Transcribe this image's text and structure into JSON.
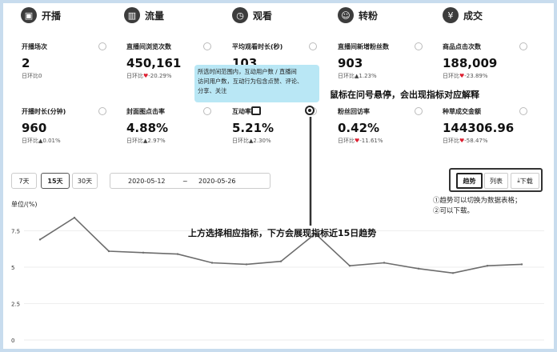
{
  "tabs": [
    {
      "label": "开播",
      "icon": "video-camera-icon",
      "glyph": "▣"
    },
    {
      "label": "流量",
      "icon": "bar-chart-icon",
      "glyph": "▥"
    },
    {
      "label": "观看",
      "icon": "clock-icon",
      "glyph": "◷"
    },
    {
      "label": "转粉",
      "icon": "add-user-icon",
      "glyph": "☺"
    },
    {
      "label": "成交",
      "icon": "yen-icon",
      "glyph": "¥"
    }
  ],
  "metrics": [
    {
      "label": "开播场次",
      "value": "2",
      "change_prefix": "日环比",
      "change_arrow": "",
      "change": "0"
    },
    {
      "label": "直播间浏览次数",
      "value": "450,161",
      "change_prefix": "日环比",
      "change_arrow": "♥",
      "change": "-20.29%"
    },
    {
      "label": "平均观看时长(秒)",
      "value": "103",
      "change_prefix": "",
      "change_arrow": "",
      "change": ""
    },
    {
      "label": "直播间新增粉丝数",
      "value": "903",
      "change_prefix": "日环比",
      "change_arrow": "▲",
      "change": "1.23%"
    },
    {
      "label": "商品点击次数",
      "value": "188,009",
      "change_prefix": "日环比",
      "change_arrow": "♥",
      "change": "-23.89%"
    },
    {
      "label": "开播时长(分钟)",
      "value": "960",
      "change_prefix": "日环比",
      "change_arrow": "▲",
      "change": "0.01%"
    },
    {
      "label": "封面图点击率",
      "value": "4.88%",
      "change_prefix": "日环比",
      "change_arrow": "▲",
      "change": "2.97%"
    },
    {
      "label": "互动率",
      "value": "5.21%",
      "change_prefix": "日环比",
      "change_arrow": "▲",
      "change": "2.30%"
    },
    {
      "label": "粉丝回访率",
      "value": "0.42%",
      "change_prefix": "日环比",
      "change_arrow": "♥",
      "change": "-11.61%"
    },
    {
      "label": "种草成交金额",
      "value": "144306.96",
      "change_prefix": "日环比",
      "change_arrow": "♥",
      "change": "-58.47%"
    }
  ],
  "tooltip": {
    "line1": "所选时间范围内，互动用户数 / 直播间",
    "line2": "访问用户数，互动行为包含点赞、评论、",
    "line3": "分享、关注"
  },
  "hover_note": "鼠标在问号悬停，会出现指标对应解释",
  "range_buttons": [
    "7天",
    "15天",
    "30天"
  ],
  "range_selected": "15天",
  "date_range": {
    "start": "2020-05-12",
    "sep": "~",
    "end": "2020-05-26"
  },
  "view_buttons": {
    "trend": "趋势",
    "list": "列表",
    "download": "下载",
    "download_glyph": "⤓"
  },
  "side_note": {
    "line1": "①趋势可以切换为数据表格；",
    "line2": "②可以下载。"
  },
  "chart_annotation": "上方选择相应指标，下方会展现指标近15日趋势",
  "colors": {
    "line": "#6c6c6c",
    "tooltip_bg": "#b9e7f5",
    "frame": "#c8dcee",
    "down": "#dd2233"
  },
  "chart_data": {
    "type": "line",
    "ylabel": "单位/(%)",
    "yticks": [
      "0",
      "2.5",
      "5",
      "7.5"
    ],
    "ylim": [
      0,
      10
    ],
    "grid": true,
    "series": [
      {
        "values": [
          6.9,
          8.4,
          6.1,
          6.0,
          5.9,
          5.3,
          5.2,
          5.4,
          7.3,
          5.1,
          5.3,
          4.9,
          4.6,
          5.1,
          5.2
        ]
      }
    ]
  }
}
